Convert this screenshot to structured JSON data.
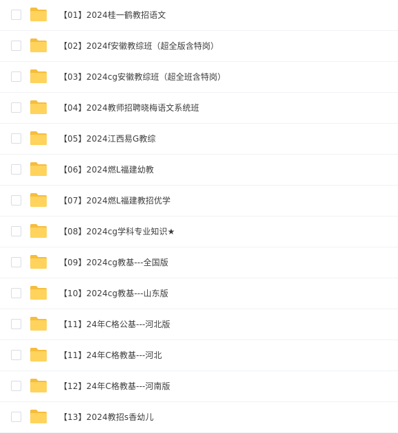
{
  "folder_icon": "folder-icon",
  "colors": {
    "folder_back": "#f6bd3c",
    "folder_front": "#ffd35c",
    "divider": "#f1f2f4",
    "text": "#3d3d3d",
    "checkbox_border": "#d9dce2"
  },
  "items": [
    {
      "name": "【01】2024桂一鹤教招语文"
    },
    {
      "name": "【02】2024f安徽教综班（超全版含特岗）"
    },
    {
      "name": "【03】2024cg安徽教综班（超全班含特岗）"
    },
    {
      "name": "【04】2024教师招聘晓梅语文系统班"
    },
    {
      "name": "【05】2024江西易G教综"
    },
    {
      "name": "【06】2024燃L福建幼教"
    },
    {
      "name": "【07】2024燃L福建教招优学"
    },
    {
      "name": "【08】2024cg学科专业知识★"
    },
    {
      "name": "【09】2024cg教基---全国版"
    },
    {
      "name": "【10】2024cg教基---山东版"
    },
    {
      "name": "【11】24年C格公基---河北版"
    },
    {
      "name": "【11】24年C格教基---河北"
    },
    {
      "name": "【12】24年C格教基---河南版"
    },
    {
      "name": "【13】2024教招s香幼儿"
    }
  ]
}
